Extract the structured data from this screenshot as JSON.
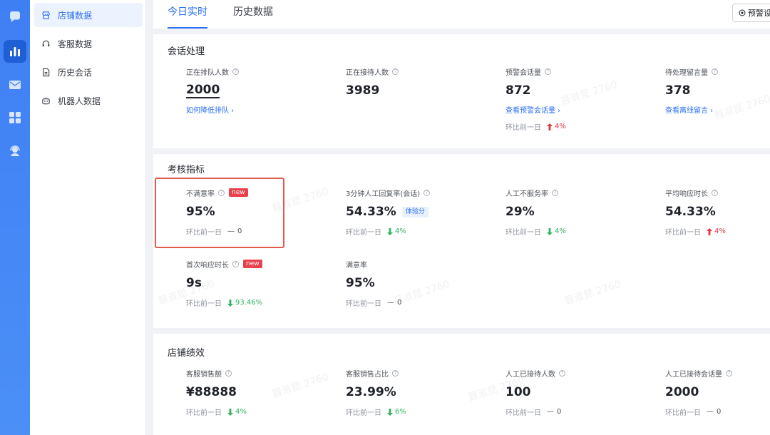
{
  "subnav": {
    "items": [
      {
        "label": "店铺数据",
        "active": true
      },
      {
        "label": "客服数据",
        "active": false
      },
      {
        "label": "历史会话",
        "active": false
      },
      {
        "label": "机器人数据",
        "active": false
      }
    ]
  },
  "tabs": [
    {
      "label": "今日实时",
      "active": true
    },
    {
      "label": "历史数据",
      "active": false
    }
  ],
  "warn_button": {
    "label": "预警设"
  },
  "compare_label": "环比前一日",
  "sections": {
    "session": {
      "title": "会话处理",
      "metrics": [
        {
          "label": "正在排队人数",
          "value": "2000",
          "link": "如何降低排队 ›"
        },
        {
          "label": "正在接待人数",
          "value": "3989"
        },
        {
          "label": "预警会话量",
          "value": "872",
          "link": "查看预警会话量 ›",
          "trend": "4%"
        },
        {
          "label": "待处理留言量",
          "value": "378",
          "link": "查看离线留言 ›"
        }
      ]
    },
    "kpi": {
      "title": "考核指标",
      "metrics": [
        {
          "label": "不满意率",
          "badge": "new",
          "value": "95%",
          "trend": "0"
        },
        {
          "label": "3分钟人工回复率(会话)",
          "value": "54.33%",
          "tag": "体验分",
          "trend": "4%"
        },
        {
          "label": "人工不服务率",
          "value": "29%",
          "trend": "4%"
        },
        {
          "label": "平均响应时长",
          "value": "54.33%",
          "trend": "4%"
        },
        {
          "label": "首次响应时长",
          "badge": "new",
          "value": "9s",
          "trend": "93.46%"
        },
        {
          "label": "满意率",
          "value": "95%",
          "trend": "0"
        }
      ]
    },
    "performance": {
      "title": "店铺绩效",
      "metrics": [
        {
          "label": "客服销售额",
          "value": "¥88888",
          "trend": "4%"
        },
        {
          "label": "客服销售占比",
          "value": "23.99%",
          "trend": "6%"
        },
        {
          "label": "人工已接待人数",
          "value": "100",
          "trend": "0"
        },
        {
          "label": "人工已接待会话量",
          "value": "2000",
          "trend": "0"
        }
      ]
    }
  },
  "flat_symbol": "—",
  "watermark": "聂淑昆 2760",
  "colors": {
    "accent": "#2b6ff5",
    "up": "#e2363f",
    "down": "#2fb35f",
    "highlight": "#e15a4c"
  }
}
